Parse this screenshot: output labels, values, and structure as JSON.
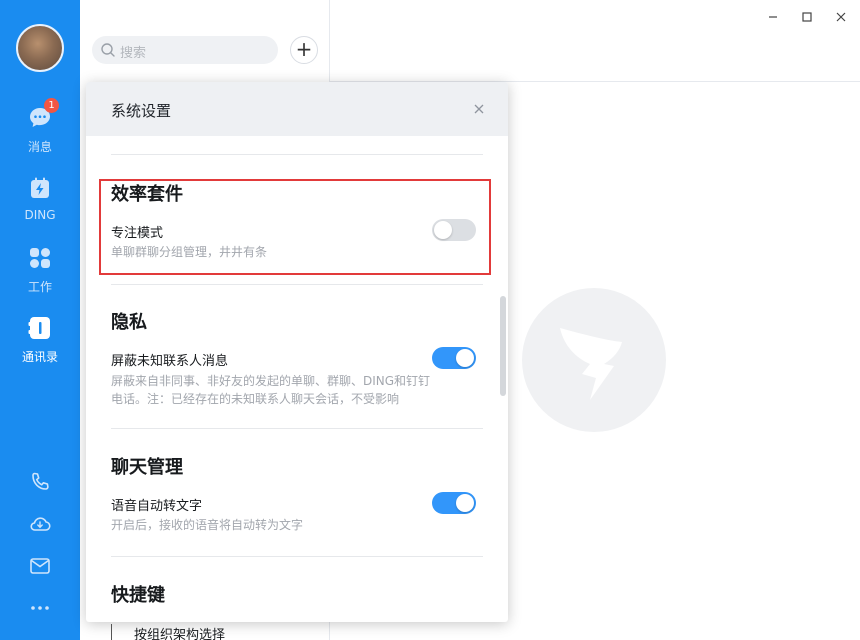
{
  "nav": {
    "items": [
      {
        "label": "消息",
        "icon": "message-icon",
        "badge": "1"
      },
      {
        "label": "DING",
        "icon": "ding-icon"
      },
      {
        "label": "工作",
        "icon": "work-grid-icon"
      },
      {
        "label": "通讯录",
        "icon": "contacts-icon",
        "active": true
      }
    ],
    "bottom_icons": [
      "phone-icon",
      "cloud-icon",
      "mail-icon",
      "more-icon"
    ]
  },
  "search": {
    "placeholder": "搜索"
  },
  "add_button": {
    "label": "+"
  },
  "settings": {
    "title": "系统设置",
    "sections": [
      {
        "title": "效率套件",
        "rows": [
          {
            "label": "专注模式",
            "desc": "单聊群聊分组管理，井井有条",
            "enabled": false
          }
        ]
      },
      {
        "title": "隐私",
        "rows": [
          {
            "label": "屏蔽未知联系人消息",
            "desc": "屏蔽来自非同事、非好友的发起的单聊、群聊、DING和钉钉电话。注：已经存在的未知联系人聊天会话，不受影响",
            "enabled": true
          }
        ]
      },
      {
        "title": "聊天管理",
        "rows": [
          {
            "label": "语音自动转文字",
            "desc": "开启后，接收的语音将自动转为文字",
            "enabled": true
          }
        ]
      },
      {
        "title": "快捷键",
        "rows": [
          {
            "label": "按组织架构选择"
          }
        ]
      }
    ]
  },
  "colors": {
    "accent": "#1a8cf0",
    "toggle_on": "#3296fa",
    "badge": "#f25643",
    "highlight": "#e23a3a"
  }
}
